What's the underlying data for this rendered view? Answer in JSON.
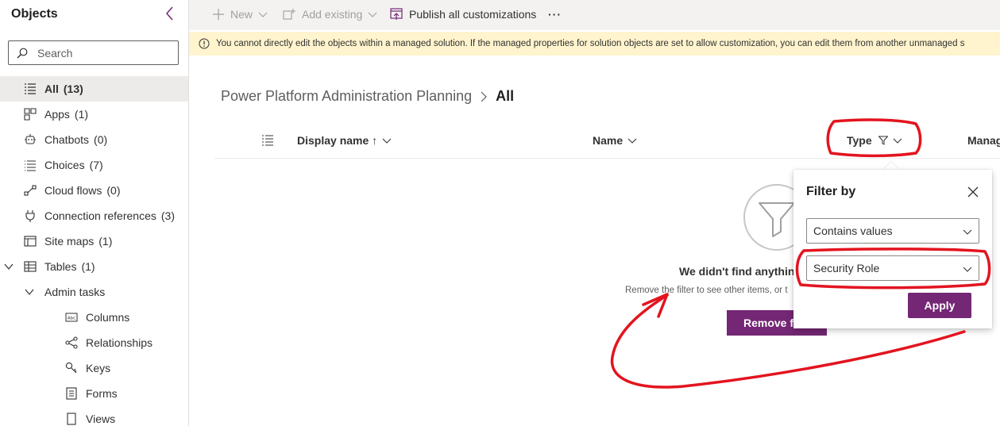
{
  "sidebar": {
    "title": "Objects",
    "search_placeholder": "Search",
    "items": [
      {
        "label": "All",
        "count": "(13)"
      },
      {
        "label": "Apps",
        "count": "(1)"
      },
      {
        "label": "Chatbots",
        "count": "(0)"
      },
      {
        "label": "Choices",
        "count": "(7)"
      },
      {
        "label": "Cloud flows",
        "count": "(0)"
      },
      {
        "label": "Connection references",
        "count": "(3)"
      },
      {
        "label": "Site maps",
        "count": "(1)"
      },
      {
        "label": "Tables",
        "count": "(1)"
      },
      {
        "label": "Admin tasks"
      },
      {
        "label": "Columns"
      },
      {
        "label": "Relationships"
      },
      {
        "label": "Keys"
      },
      {
        "label": "Forms"
      },
      {
        "label": "Views"
      }
    ]
  },
  "toolbar": {
    "new_label": "New",
    "add_existing_label": "Add existing",
    "publish_label": "Publish all customizations",
    "more_label": "···"
  },
  "warning": {
    "text": "You cannot directly edit the objects within a managed solution. If the managed properties for solution objects are set to allow customization, you can edit them from another unmanaged s"
  },
  "breadcrumb": {
    "parent": "Power Platform Administration Planning",
    "separator": ">",
    "current": "All"
  },
  "columns": {
    "display_name": "Display name ↑",
    "name": "Name",
    "type": "Type",
    "managed": "Manag"
  },
  "empty_state": {
    "title": "We didn't find anythin",
    "subtitle": "Remove the filter to see other items, or t",
    "button": "Remove filter"
  },
  "filter_panel": {
    "title": "Filter by",
    "operator_value": "Contains values",
    "value": "Security Role",
    "apply_label": "Apply"
  },
  "colors": {
    "accent": "#742774",
    "annotation": "#e3141f",
    "warning_bg": "#fff4ce"
  }
}
